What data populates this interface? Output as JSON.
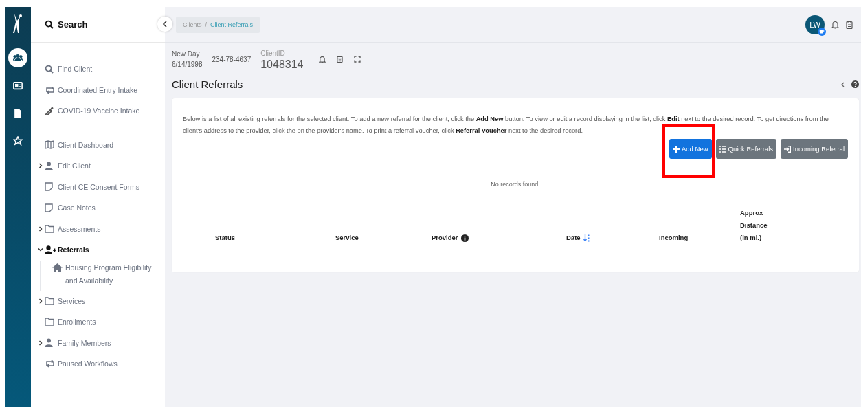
{
  "rail": {
    "items": [
      {
        "selected": true
      },
      {
        "selected": false
      },
      {
        "selected": false
      },
      {
        "selected": false
      }
    ]
  },
  "sidebar": {
    "search_title": "Search",
    "items": [
      {
        "label": "Find Client",
        "selected": false
      },
      {
        "label": "Coordinated Entry Intake",
        "selected": false
      },
      {
        "label": "COVID-19 Vaccine Intake",
        "selected": false
      },
      {
        "label": "Client Dashboard",
        "selected": false
      },
      {
        "label": "Edit Client",
        "selected": false,
        "expanded": false
      },
      {
        "label": "Client CE Consent Forms",
        "selected": false
      },
      {
        "label": "Case Notes",
        "selected": false
      },
      {
        "label": "Assessments",
        "selected": false,
        "expanded": false
      },
      {
        "label": "Referrals",
        "selected": true,
        "expanded": true,
        "children": [
          {
            "label": "Housing Program Eligibility and Availability",
            "selected": false
          }
        ]
      },
      {
        "label": "Services",
        "selected": false,
        "expanded": false
      },
      {
        "label": "Enrollments",
        "selected": false
      },
      {
        "label": "Family Members",
        "selected": false,
        "expanded": false
      },
      {
        "label": "Paused Workflows",
        "selected": false
      }
    ]
  },
  "breadcrumb": [
    "Clients",
    "Client Referrals"
  ],
  "breadcrumb_separator": "/",
  "user": {
    "initials": "LW"
  },
  "client": {
    "name": "New Day",
    "dob": "6/14/1998",
    "ssn": "234-78-4637",
    "id_label": "ClientID",
    "id": "1048314"
  },
  "page_title": "Client Referrals",
  "intro": "Below is a list of all existing referrals for the selected client. To add a new referral for the client, click the **Add New** button.  To view or edit a record displaying in the list, click **Edit** next to the desired record.  To get directions from the client's address to the provider, click the on the provider's name.  To print a referral voucher, click **Referral Voucher** next to the desired record.",
  "buttons": [
    {
      "label": "Add New",
      "kind": "primary",
      "highlighted": true
    },
    {
      "label": "Quick Referrals",
      "kind": "secondary",
      "highlighted": false
    },
    {
      "label": "Incoming Referral",
      "kind": "secondary",
      "highlighted": false
    }
  ],
  "empty_message": "No records found.",
  "table": {
    "columns": [
      {
        "label": "Status",
        "kind": "plain"
      },
      {
        "label": "Service",
        "kind": "plain"
      },
      {
        "label": "Provider",
        "kind": "info"
      },
      {
        "label": "Date",
        "kind": "sort"
      },
      {
        "label": "Incoming",
        "kind": "plain"
      },
      {
        "label": "Approx Distance (in mi.)",
        "kind": "plain"
      }
    ]
  }
}
